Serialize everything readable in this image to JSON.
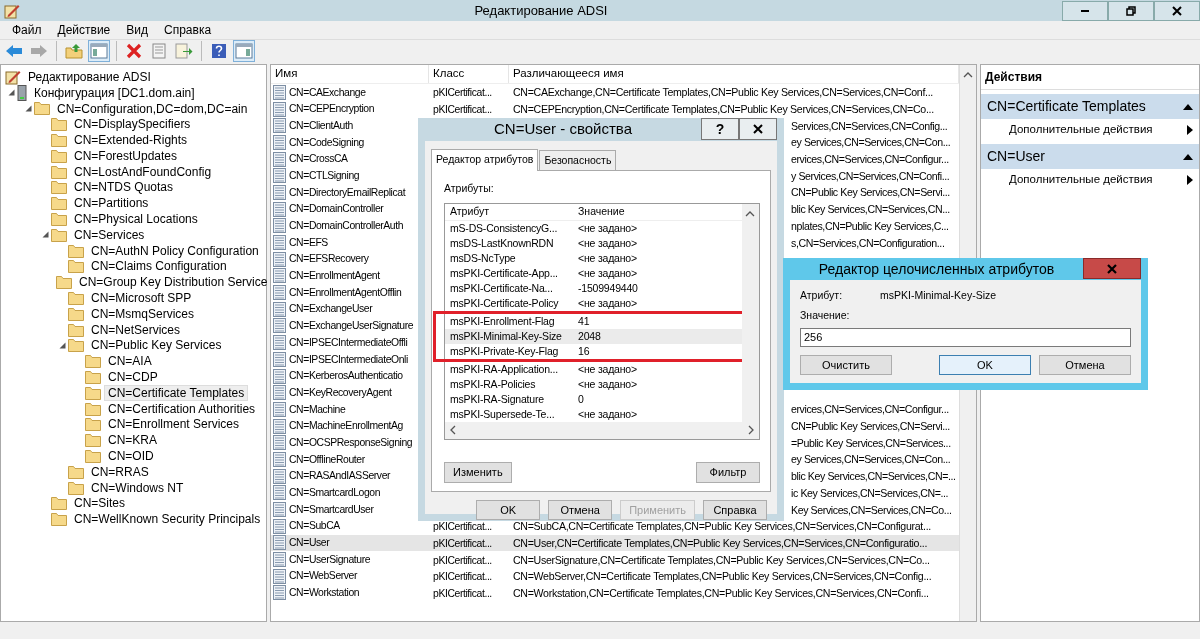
{
  "window": {
    "title": "Редактирование ADSI"
  },
  "menu": [
    "Файл",
    "Действие",
    "Вид",
    "Справка"
  ],
  "toolbar": [
    {
      "kind": "back",
      "disabled": false
    },
    {
      "kind": "forward",
      "disabled": true
    },
    {
      "kind": "separator"
    },
    {
      "kind": "up",
      "pressed": false
    },
    {
      "kind": "console_tree",
      "pressed": true
    },
    {
      "kind": "separator"
    },
    {
      "kind": "delete",
      "pressed": false
    },
    {
      "kind": "properties",
      "pressed": false
    },
    {
      "kind": "export",
      "pressed": false
    },
    {
      "kind": "separator"
    },
    {
      "kind": "help",
      "pressed": false
    },
    {
      "kind": "action_pane",
      "pressed": true
    }
  ],
  "tree": {
    "label": "Редактирование ADSI",
    "kind": "root",
    "selected": false,
    "children": [
      {
        "label": "Конфигурация [DC1.dom.ain]",
        "kind": "server",
        "selected": false,
        "expanded": true,
        "children": [
          {
            "label": "CN=Configuration,DC=dom,DC=ain",
            "kind": "folder",
            "selected": false,
            "expanded": true,
            "children": [
              {
                "label": "CN=DisplaySpecifiers",
                "kind": "folder",
                "selected": false
              },
              {
                "label": "CN=Extended-Rights",
                "kind": "folder",
                "selected": false
              },
              {
                "label": "CN=ForestUpdates",
                "kind": "folder",
                "selected": false
              },
              {
                "label": "CN=LostAndFoundConfig",
                "kind": "folder",
                "selected": false
              },
              {
                "label": "CN=NTDS Quotas",
                "kind": "folder",
                "selected": false
              },
              {
                "label": "CN=Partitions",
                "kind": "folder",
                "selected": false
              },
              {
                "label": "CN=Physical Locations",
                "kind": "folder",
                "selected": false
              },
              {
                "label": "CN=Services",
                "kind": "folder",
                "selected": false,
                "expanded": true,
                "children": [
                  {
                    "label": "CN=AuthN Policy Configuration",
                    "kind": "folder",
                    "selected": false
                  },
                  {
                    "label": "CN=Claims Configuration",
                    "kind": "folder",
                    "selected": false
                  },
                  {
                    "label": "CN=Group Key Distribution Service",
                    "kind": "folder",
                    "selected": false
                  },
                  {
                    "label": "CN=Microsoft SPP",
                    "kind": "folder",
                    "selected": false
                  },
                  {
                    "label": "CN=MsmqServices",
                    "kind": "folder",
                    "selected": false
                  },
                  {
                    "label": "CN=NetServices",
                    "kind": "folder",
                    "selected": false
                  },
                  {
                    "label": "CN=Public Key Services",
                    "kind": "folder",
                    "selected": false,
                    "expanded": true,
                    "children": [
                      {
                        "label": "CN=AIA",
                        "kind": "folder",
                        "selected": false
                      },
                      {
                        "label": "CN=CDP",
                        "kind": "folder",
                        "selected": false
                      },
                      {
                        "label": "CN=Certificate Templates",
                        "kind": "folder",
                        "selected": true
                      },
                      {
                        "label": "CN=Certification Authorities",
                        "kind": "folder",
                        "selected": false
                      },
                      {
                        "label": "CN=Enrollment Services",
                        "kind": "folder",
                        "selected": false
                      },
                      {
                        "label": "CN=KRA",
                        "kind": "folder",
                        "selected": false
                      },
                      {
                        "label": "CN=OID",
                        "kind": "folder",
                        "selected": false
                      }
                    ]
                  },
                  {
                    "label": "CN=RRAS",
                    "kind": "folder",
                    "selected": false
                  },
                  {
                    "label": "CN=Windows NT",
                    "kind": "folder",
                    "selected": false
                  }
                ]
              },
              {
                "label": "CN=Sites",
                "kind": "folder",
                "selected": false
              },
              {
                "label": "CN=WellKnown Security Principals",
                "kind": "folder",
                "selected": false
              }
            ]
          }
        ]
      }
    ]
  },
  "list": {
    "columns": [
      "Имя",
      "Класс",
      "Различающееся имя"
    ],
    "rows": [
      {
        "name": "CN=CAExchange",
        "class": "pKICertificat...",
        "dn": "CN=CAExchange,CN=Certificate Templates,CN=Public Key Services,CN=Services,CN=Conf...",
        "selected": false
      },
      {
        "name": "CN=CEPEncryption",
        "class": "pKICertificat...",
        "dn": "CN=CEPEncryption,CN=Certificate Templates,CN=Public Key Services,CN=Services,CN=Co...",
        "selected": false
      },
      {
        "name": "CN=ClientAuth",
        "dn_visible": "Services,CN=Services,CN=Config...",
        "selected": false
      },
      {
        "name": "CN=CodeSigning",
        "dn_visible": "ey Services,CN=Services,CN=Con...",
        "selected": false
      },
      {
        "name": "CN=CrossCA",
        "dn_visible": "ervices,CN=Services,CN=Configur...",
        "selected": false
      },
      {
        "name": "CN=CTLSigning",
        "dn_visible": "y Services,CN=Services,CN=Confi...",
        "selected": false
      },
      {
        "name": "CN=DirectoryEmailReplicat",
        "dn_visible": "CN=Public Key Services,CN=Servi...",
        "selected": false
      },
      {
        "name": "CN=DomainController",
        "dn_visible": "blic Key Services,CN=Services,CN...",
        "selected": false
      },
      {
        "name": "CN=DomainControllerAuth",
        "dn_visible": "nplates,CN=Public Key Services,C...",
        "selected": false
      },
      {
        "name": "CN=EFS",
        "dn_visible": "s,CN=Services,CN=Configuration...",
        "selected": false
      },
      {
        "name": "CN=EFSRecovery",
        "selected": false
      },
      {
        "name": "CN=EnrollmentAgent",
        "selected": false
      },
      {
        "name": "CN=EnrollmentAgentOfflin",
        "selected": false
      },
      {
        "name": "CN=ExchangeUser",
        "selected": false
      },
      {
        "name": "CN=ExchangeUserSignature",
        "selected": false
      },
      {
        "name": "CN=IPSECIntermediateOffli",
        "selected": false
      },
      {
        "name": "CN=IPSECIntermediateOnli",
        "selected": false
      },
      {
        "name": "CN=KerberosAuthenticatio",
        "selected": false
      },
      {
        "name": "CN=KeyRecoveryAgent",
        "selected": false
      },
      {
        "name": "CN=Machine",
        "dn_visible": "ervices,CN=Services,CN=Configur...",
        "selected": false
      },
      {
        "name": "CN=MachineEnrollmentAg",
        "dn_visible": "CN=Public Key Services,CN=Servi...",
        "selected": false
      },
      {
        "name": "CN=OCSPResponseSigning",
        "dn_visible": "=Public Key Services,CN=Services...",
        "selected": false
      },
      {
        "name": "CN=OfflineRouter",
        "dn_visible": "ey Services,CN=Services,CN=Con...",
        "selected": false
      },
      {
        "name": "CN=RASAndIASServer",
        "dn_visible": "blic Key Services,CN=Services,CN=...",
        "selected": false
      },
      {
        "name": "CN=SmartcardLogon",
        "dn_visible": "ic Key Services,CN=Services,CN=...",
        "selected": false
      },
      {
        "name": "CN=SmartcardUser",
        "dn_visible": "Key Services,CN=Services,CN=Co...",
        "selected": false
      },
      {
        "name": "CN=SubCA",
        "class": "pKICertificat...",
        "dn": "CN=SubCA,CN=Certificate Templates,CN=Public Key Services,CN=Services,CN=Configurat...",
        "selected": false
      },
      {
        "name": "CN=User",
        "class": "pKICertificat...",
        "dn": "CN=User,CN=Certificate Templates,CN=Public Key Services,CN=Services,CN=Configuratio...",
        "selected": true
      },
      {
        "name": "CN=UserSignature",
        "class": "pKICertificat...",
        "dn": "CN=UserSignature,CN=Certificate Templates,CN=Public Key Services,CN=Services,CN=Co...",
        "selected": false
      },
      {
        "name": "CN=WebServer",
        "class": "pKICertificat...",
        "dn": "CN=WebServer,CN=Certificate Templates,CN=Public Key Services,CN=Services,CN=Config...",
        "selected": false
      },
      {
        "name": "CN=Workstation",
        "class": "pKICertificat...",
        "dn": "CN=Workstation,CN=Certificate Templates,CN=Public Key Services,CN=Services,CN=Confi...",
        "selected": false
      }
    ]
  },
  "actions": {
    "title": "Действия",
    "groups": [
      {
        "title": "CN=Certificate Templates",
        "items": [
          "Дополнительные действия"
        ]
      },
      {
        "title": "CN=User",
        "items": [
          "Дополнительные действия"
        ]
      }
    ]
  },
  "properties_dialog": {
    "title": "CN=User - свойства",
    "help_button": "?",
    "tabs": [
      {
        "label": "Редактор атрибутов",
        "selected": true
      },
      {
        "label": "Безопасность",
        "selected": false
      }
    ],
    "attributes_label": "Атрибуты:",
    "columns": [
      "Атрибут",
      "Значение"
    ],
    "rows": [
      {
        "attribute": "mS-DS-ConsistencyG...",
        "value": "<не задано>",
        "selected": false,
        "highlighted": false
      },
      {
        "attribute": "msDS-LastKnownRDN",
        "value": "<не задано>",
        "selected": false,
        "highlighted": false
      },
      {
        "attribute": "msDS-NcType",
        "value": "<не задано>",
        "selected": false,
        "highlighted": false
      },
      {
        "attribute": "msPKI-Certificate-App...",
        "value": "<не задано>",
        "selected": false,
        "highlighted": false
      },
      {
        "attribute": "msPKI-Certificate-Na...",
        "value": "-1509949440",
        "selected": false,
        "highlighted": false
      },
      {
        "attribute": "msPKI-Certificate-Policy",
        "value": "<не задано>",
        "selected": false,
        "highlighted": false
      },
      {
        "attribute": "msPKI-Enrollment-Flag",
        "value": "41",
        "selected": false,
        "highlighted": true
      },
      {
        "attribute": "msPKI-Minimal-Key-Size",
        "value": "2048",
        "selected": true,
        "highlighted": true
      },
      {
        "attribute": "msPKI-Private-Key-Flag",
        "value": "16",
        "selected": false,
        "highlighted": true
      },
      {
        "attribute": "msPKI-RA-Application...",
        "value": "<не задано>",
        "selected": false,
        "highlighted": false
      },
      {
        "attribute": "msPKI-RA-Policies",
        "value": "<не задано>",
        "selected": false,
        "highlighted": false
      },
      {
        "attribute": "msPKI-RA-Signature",
        "value": "0",
        "selected": false,
        "highlighted": false
      },
      {
        "attribute": "msPKI-Supersede-Te...",
        "value": "<не задано>",
        "selected": false,
        "highlighted": false
      }
    ],
    "list_buttons": [
      "Изменить",
      "Фильтр"
    ],
    "buttons": [
      {
        "label": "OK",
        "disabled": false
      },
      {
        "label": "Отмена",
        "disabled": false
      },
      {
        "label": "Применить",
        "disabled": true
      },
      {
        "label": "Справка",
        "disabled": false
      }
    ]
  },
  "integer_editor": {
    "title": "Редактор целочисленных атрибутов",
    "attribute_label": "Атрибут:",
    "attribute": "msPKI-Minimal-Key-Size",
    "value_label": "Значение:",
    "value": "256",
    "buttons": [
      {
        "label": "Очистить",
        "default": false
      },
      {
        "label": "OK",
        "default": true
      },
      {
        "label": "Отмена",
        "default": false
      }
    ]
  }
}
